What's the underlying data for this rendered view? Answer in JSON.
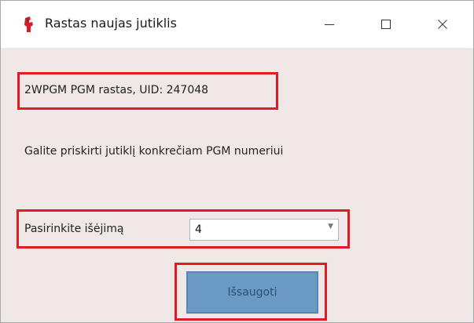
{
  "window": {
    "title": "Rastas naujas jutiklis",
    "icon": "red-fist-icon",
    "controls": {
      "minimize": "minimize-icon",
      "maximize": "maximize-icon",
      "close": "close-icon"
    }
  },
  "content": {
    "uid_text": "2WPGM PGM rastas, UID: 247048",
    "hint_text": "Galite priskirti jutiklį konkrečiam PGM numeriui",
    "output_label": "Pasirinkite išėjimą",
    "output_select": {
      "selected_value": "4"
    },
    "save_label": "Išsaugoti"
  },
  "colors": {
    "window_background": "#efe8e6",
    "titlebar_background": "#ffffff",
    "highlight_border": "#e01b24",
    "button_background": "#6b9ac6",
    "button_text": "#2e4f74"
  }
}
